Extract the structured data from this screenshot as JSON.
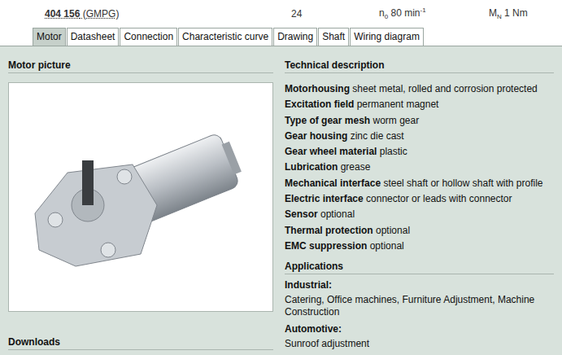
{
  "header": {
    "code": "404 156",
    "type": "(GMPG)",
    "voltage": "24",
    "speed": {
      "symbol": "n",
      "sub": "0",
      "value": "80 min",
      "sup": "-1"
    },
    "torque": {
      "symbol": "M",
      "sub": "N",
      "value": "1 Nm"
    }
  },
  "tabs": [
    {
      "label": "Motor",
      "selected": true
    },
    {
      "label": "Datasheet",
      "selected": false
    },
    {
      "label": "Connection",
      "selected": false
    },
    {
      "label": "Characteristic curve",
      "selected": false
    },
    {
      "label": "Drawing",
      "selected": false
    },
    {
      "label": "Shaft",
      "selected": false
    },
    {
      "label": "Wiring diagram",
      "selected": false
    }
  ],
  "left": {
    "picture_title": "Motor picture",
    "downloads_title": "Downloads"
  },
  "technical": {
    "title": "Technical description",
    "rows": [
      {
        "label": "Motorhousing",
        "value": "sheet metal, rolled and corrosion protected"
      },
      {
        "label": "Excitation field",
        "value": "permanent magnet"
      },
      {
        "label": "Type of gear mesh",
        "value": "worm gear"
      },
      {
        "label": "Gear housing",
        "value": "zinc die cast"
      },
      {
        "label": "Gear wheel material",
        "value": "plastic"
      },
      {
        "label": "Lubrication",
        "value": "grease"
      },
      {
        "label": "Mechanical interface",
        "value": "steel shaft or hollow shaft with profile"
      },
      {
        "label": "Electric interface",
        "value": "connector or leads with connector"
      },
      {
        "label": "Sensor",
        "value": "optional"
      },
      {
        "label": "Thermal protection",
        "value": "optional"
      },
      {
        "label": "EMC suppression",
        "value": "optional"
      }
    ]
  },
  "applications": {
    "title": "Applications",
    "groups": [
      {
        "label": "Industrial:",
        "text": "Catering, Office machines, Furniture Adjustment, Machine Construction"
      },
      {
        "label": "Automotive:",
        "text": "Sunroof adjustment"
      }
    ]
  }
}
